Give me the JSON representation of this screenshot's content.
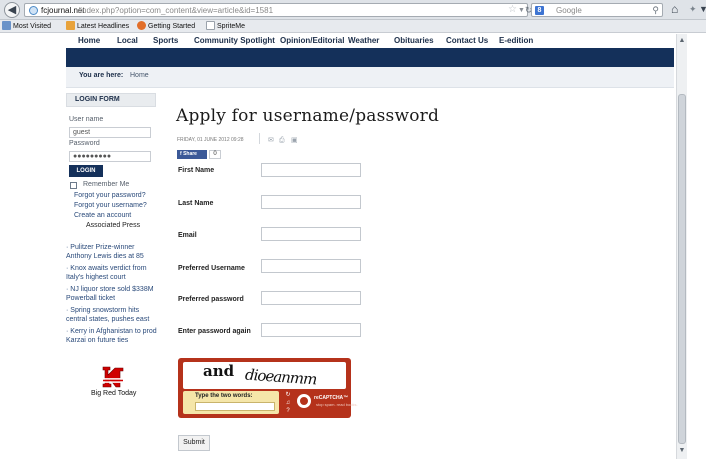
{
  "browser": {
    "url_domain": "fcjournal.net",
    "url_path": "/index.php?option=com_content&view=article&id=1581",
    "search_engine": "Google",
    "bookmarks": [
      "Most Visited",
      "Latest Headlines",
      "Getting Started",
      "SpriteMe"
    ]
  },
  "site": {
    "menu": [
      "Home",
      "Local",
      "Sports",
      "Community Spotlight",
      "Opinion/Editorial",
      "Weather",
      "Obituaries",
      "Contact Us",
      "E-edition"
    ],
    "breadcrumb_label": "You are here:",
    "breadcrumb_home": "Home",
    "accent_color": "#14305a"
  },
  "sidebar": {
    "login_title": "LOGIN FORM",
    "username_label": "User name",
    "username_value": "guest",
    "password_label": "Password",
    "password_value": "●●●●●●●●●",
    "login_button": "LOGIN",
    "remember_me": "Remember Me",
    "links": [
      "Forgot your password?",
      "Forgot your username?",
      "Create an account"
    ],
    "news_source": "Associated Press",
    "news": [
      [
        "· Pulitzer Prize-winner",
        "Anthony Lewis dies at 85"
      ],
      [
        "· Knox awaits verdict from",
        "Italy's highest court"
      ],
      [
        "· NJ liquor store sold $338M",
        "Powerball ticket"
      ],
      [
        "· Spring snowstorm hits",
        "central states, pushes east"
      ],
      [
        "· Kerry in Afghanistan to prod",
        "Karzai on future ties"
      ]
    ],
    "logo_label": "Big Red Today"
  },
  "article": {
    "title": "Apply for username/password",
    "date": "FRIDAY, 01 JUNE 2012 09:28",
    "share_label": "Share",
    "share_count": "0"
  },
  "form": {
    "fields": [
      "First Name",
      "Last Name",
      "Email",
      "Preferred Username",
      "Preferred password",
      "Enter password again"
    ],
    "submit": "Submit"
  },
  "captcha": {
    "word1": "and",
    "word2": "dioeanmm",
    "prompt": "Type the two words:",
    "brand": "reCAPTCHA™",
    "tagline": "stop spam. read books."
  }
}
